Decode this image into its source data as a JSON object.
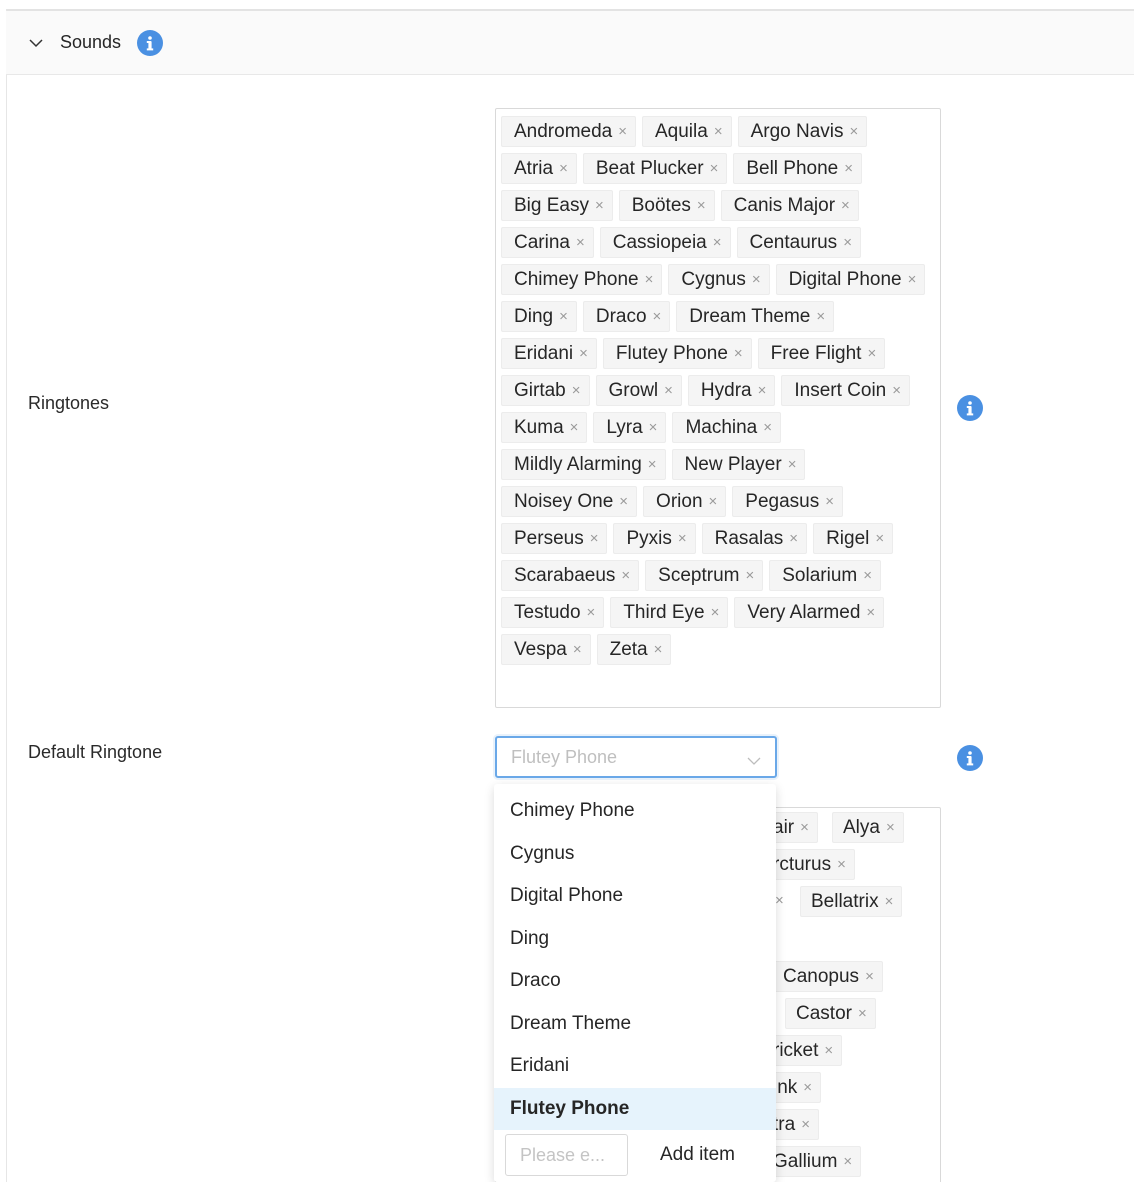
{
  "section": {
    "title": "Sounds"
  },
  "ringtones": {
    "label": "Ringtones",
    "tags": [
      "Andromeda",
      "Aquila",
      "Argo Navis",
      "Atria",
      "Beat Plucker",
      "Bell Phone",
      "Big Easy",
      "Boötes",
      "Canis Major",
      "Carina",
      "Cassiopeia",
      "Centaurus",
      "Chimey Phone",
      "Cygnus",
      "Digital Phone",
      "Ding",
      "Draco",
      "Dream Theme",
      "Eridani",
      "Flutey Phone",
      "Free Flight",
      "Girtab",
      "Growl",
      "Hydra",
      "Insert Coin",
      "Kuma",
      "Lyra",
      "Machina",
      "Mildly Alarming",
      "New Player",
      "Noisey One",
      "Orion",
      "Pegasus",
      "Perseus",
      "Pyxis",
      "Rasalas",
      "Rigel",
      "Scarabaeus",
      "Sceptrum",
      "Solarium",
      "Testudo",
      "Third Eye",
      "Very Alarmed",
      "Vespa",
      "Zeta"
    ],
    "remove_glyph": "×"
  },
  "default_ringtone": {
    "label": "Default Ringtone",
    "selected": "Flutey Phone",
    "options": [
      "Chimey Phone",
      "Cygnus",
      "Digital Phone",
      "Ding",
      "Draco",
      "Dream Theme",
      "Eridani",
      "Flutey Phone"
    ],
    "active_option": "Flutey Phone",
    "add_placeholder": "Please e...",
    "add_label": "Add item"
  },
  "hidden_tags": {
    "tags": [
      "air",
      "Alya",
      "rcturus",
      "Bellatrix",
      "Canopus",
      "Castor",
      "ricket",
      "ink",
      "tra",
      "Gallium"
    ]
  },
  "colors": {
    "info": "#4a90e2",
    "select_border": "#6aa8e8",
    "active_option_bg": "#e6f3fc"
  }
}
